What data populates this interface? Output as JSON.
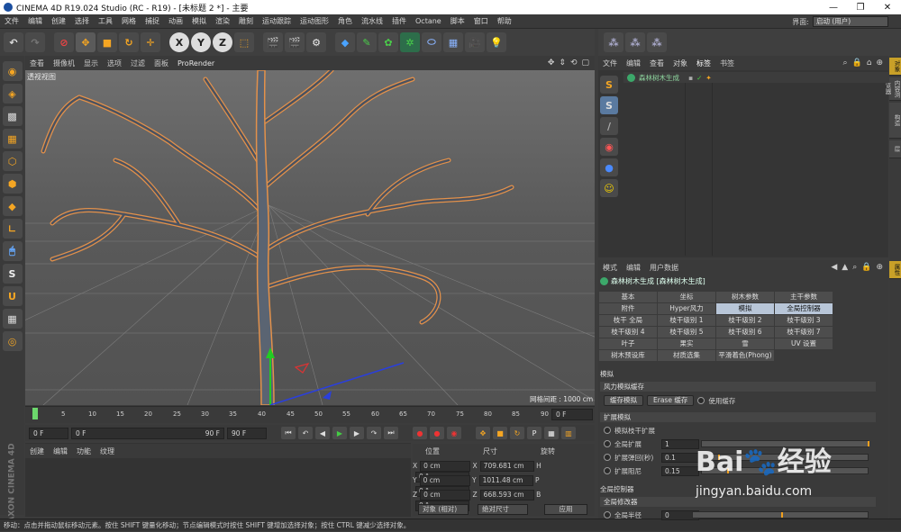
{
  "window": {
    "title": "CINEMA 4D R19.024 Studio (RC - R19) - [未标题 2 *] - 主要",
    "min": "—",
    "max": "❐",
    "close": "✕"
  },
  "menu": {
    "items": [
      "文件",
      "编辑",
      "创建",
      "选择",
      "工具",
      "网格",
      "捕捉",
      "动画",
      "模拟",
      "渲染",
      "雕刻",
      "运动跟踪",
      "运动图形",
      "角色",
      "流水线",
      "插件",
      "Octane",
      "脚本",
      "窗口",
      "帮助"
    ],
    "layout_label": "界面:",
    "layout_value": "启动 (用户)"
  },
  "toolbar": {
    "x_label": "X",
    "y_label": "Y",
    "z_label": "Z"
  },
  "viewport": {
    "menu": [
      "查看",
      "摄像机",
      "显示",
      "选项",
      "过滤",
      "面板",
      "ProRender"
    ],
    "label": "透视视图",
    "grid_label": "网格间距 : 1000 cm"
  },
  "timeline": {
    "ticks": [
      "0",
      "5",
      "10",
      "15",
      "20",
      "25",
      "30",
      "35",
      "40",
      "45",
      "50",
      "55",
      "60",
      "65",
      "70",
      "75",
      "80",
      "85",
      "90"
    ],
    "current": "0 F",
    "start": "0 F",
    "pos": "0 F",
    "end": "90 F",
    "end2": "90 F"
  },
  "material": {
    "menu": [
      "创建",
      "编辑",
      "功能",
      "纹理"
    ]
  },
  "coords": {
    "headers": [
      "位置",
      "尺寸",
      "旋转"
    ],
    "rows": [
      {
        "a": "X",
        "av": "0 cm",
        "b": "X",
        "bv": "709.681 cm",
        "c": "H",
        "cv": "0 °"
      },
      {
        "a": "Y",
        "av": "0 cm",
        "b": "Y",
        "bv": "1011.48 cm",
        "c": "P",
        "cv": "0 °"
      },
      {
        "a": "Z",
        "av": "0 cm",
        "b": "Z",
        "bv": "668.593 cm",
        "c": "B",
        "cv": "0 °"
      }
    ],
    "mode": "对象 (相对)",
    "size_mode": "绝对尺寸",
    "apply": "应用"
  },
  "objects": {
    "menu": [
      "文件",
      "编辑",
      "查看",
      "对象",
      "标签",
      "书签"
    ],
    "item": "森林树木生成"
  },
  "attributes": {
    "menu": [
      "模式",
      "编辑",
      "用户数据"
    ],
    "title": "森林树木生成 [森林树木生成]",
    "tabs": [
      "基本",
      "坐标",
      "树木参数",
      "主干参数",
      "附件",
      "Hyper风力",
      "模拟",
      "全局控制器",
      "枝干 全局",
      "枝干级别 1",
      "枝干级别 2",
      "枝干级别 3",
      "枝干级别 4",
      "枝干级别 5",
      "枝干级别 6",
      "枝干级别 7",
      "叶子",
      "果实",
      "雪",
      "UV 设置",
      "树木预设库",
      "材质选集",
      "平滑着色(Phong)"
    ],
    "section1": "模拟",
    "group1": "风力模拟缓存",
    "cache_btn": "缓存模拟",
    "erase_btn": "Erase 缓存",
    "use_cache": "使用缓存",
    "group2": "扩展模拟",
    "ext1": "模拟枝干扩展",
    "ext2": "全局扩展",
    "ext2_val": "1",
    "ext3": "扩展弹回(秒)",
    "ext3_val": "0.1",
    "ext4": "扩展阻尼",
    "ext4_val": "0.15",
    "section2": "全局控制器",
    "group3": "全局修改器",
    "glob1": "全局半径",
    "glob1_val": "0"
  },
  "edge_tabs": [
    "对象",
    "内容浏览器",
    "构造",
    "层"
  ],
  "edge_tabs2": [
    "属性"
  ],
  "maxon": "MAXON CINEMA 4D",
  "status": "移动：点击并拖动鼠标移动元素。按住 SHIFT 键量化移动；节点编辑模式时按住 SHIFT 键增加选择对象；按住 CTRL 键减少选择对象。",
  "watermark": {
    "brand": "Bai",
    "brand2": "经验",
    "url": "jingyan.baidu.com"
  }
}
